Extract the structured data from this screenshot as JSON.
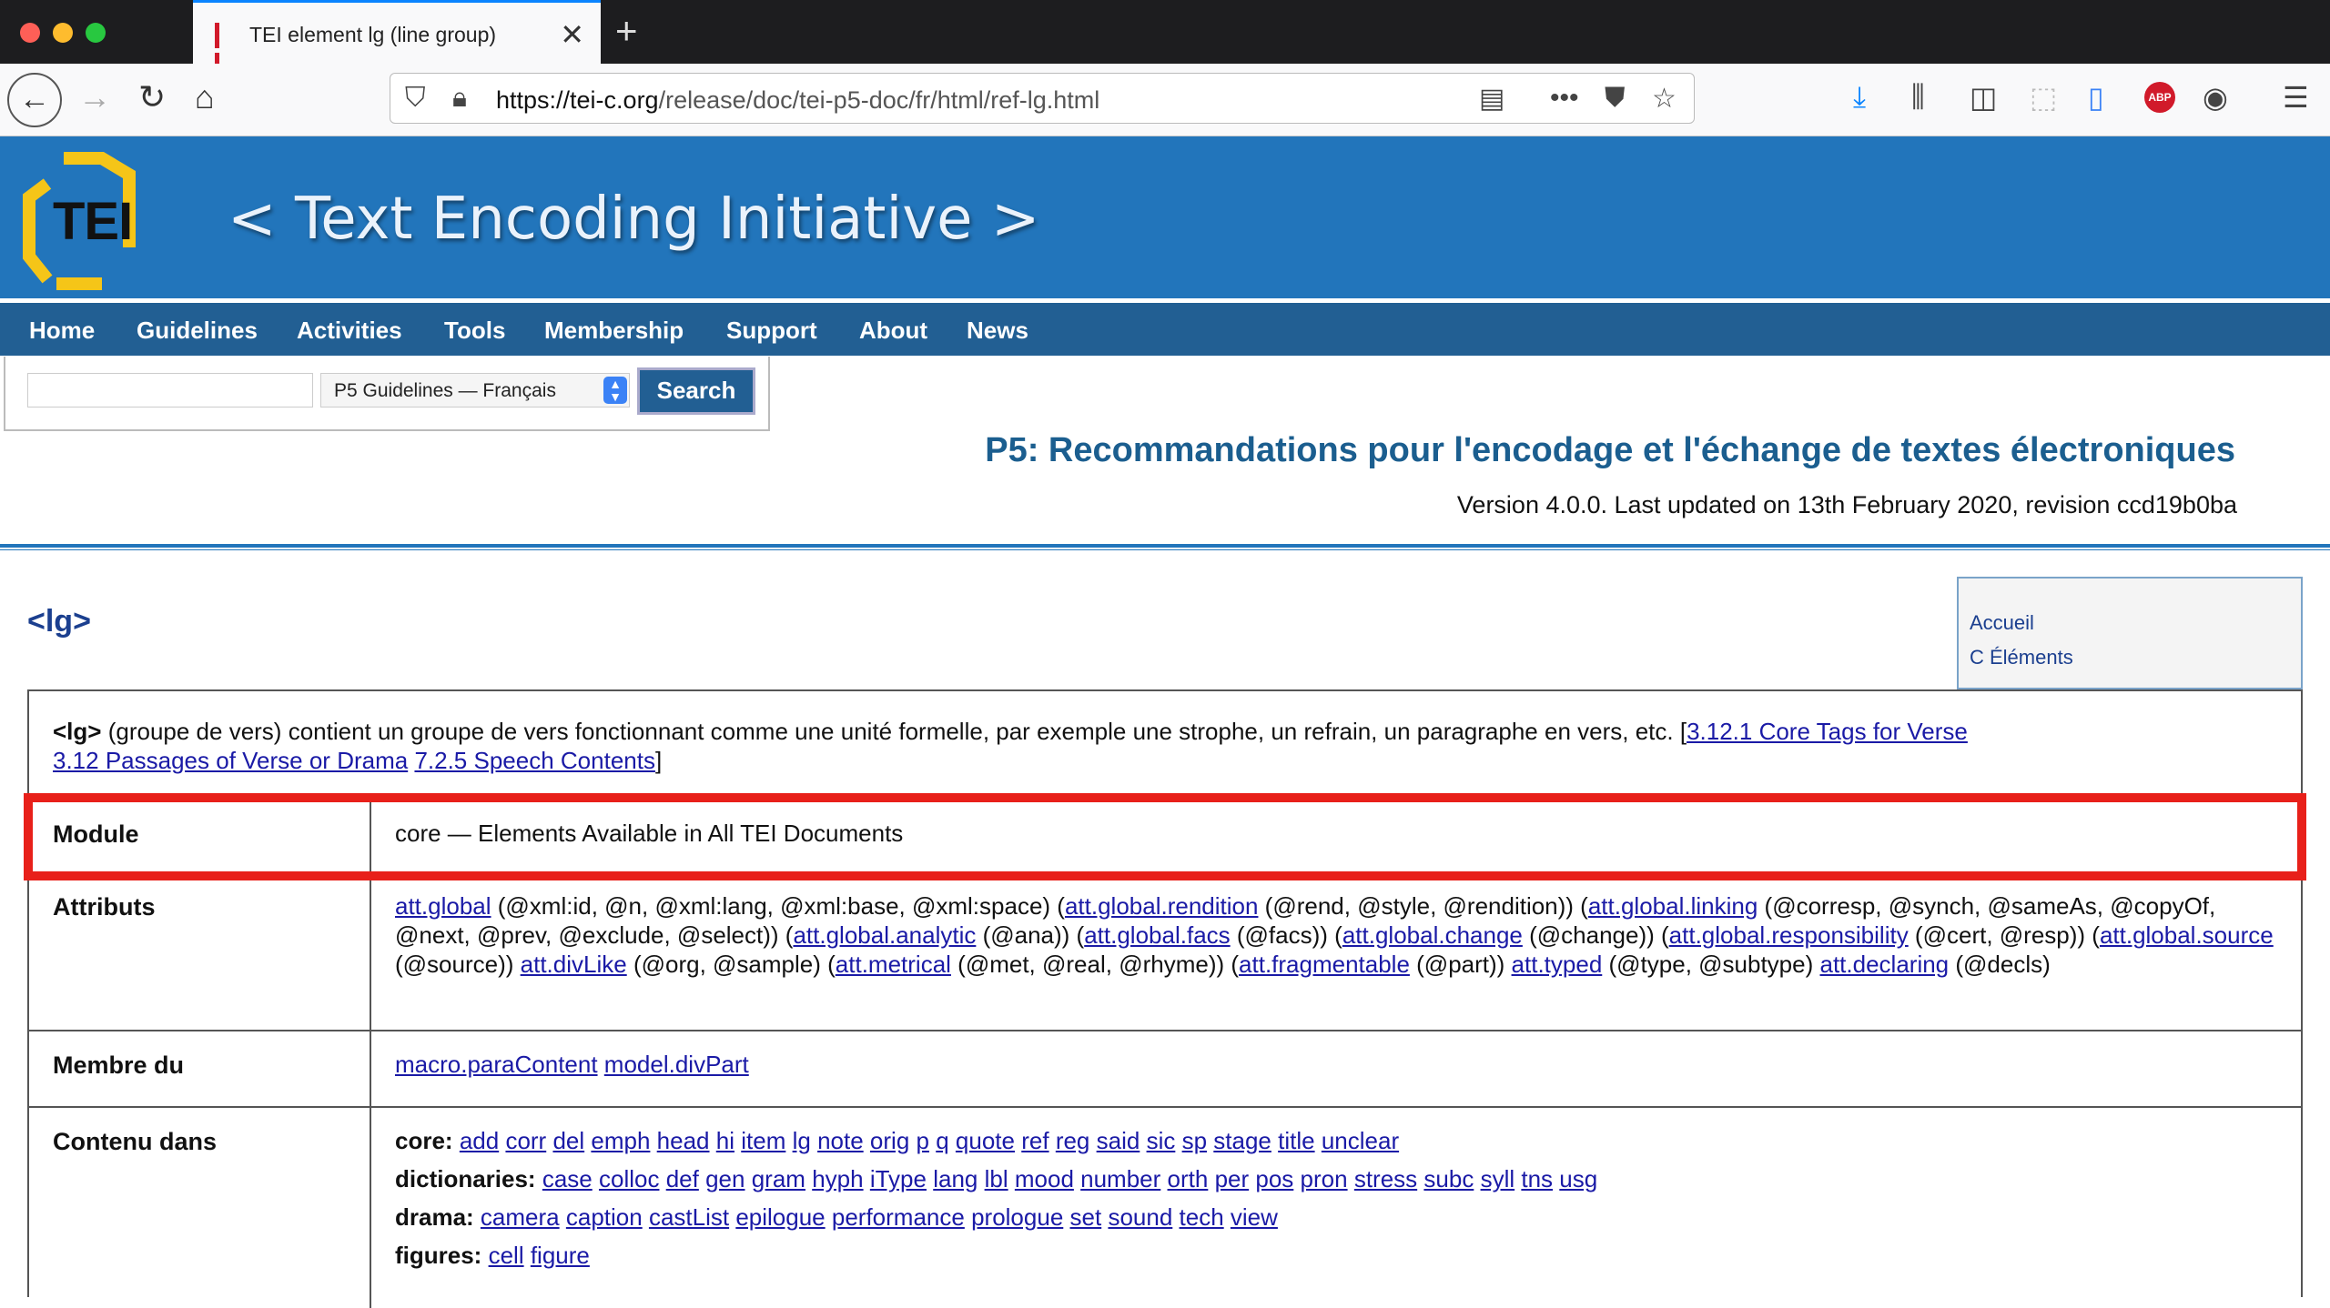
{
  "browser": {
    "tab_title": "TEI element lg (line group)",
    "url_host": "https://tei-c.org",
    "url_path": "/release/doc/tei-p5-doc/fr/html/ref-lg.html"
  },
  "site": {
    "logo": "TEI",
    "title": "< Text Encoding Initiative >",
    "nav": [
      "Home",
      "Guidelines",
      "Activities",
      "Tools",
      "Membership",
      "Support",
      "About",
      "News"
    ],
    "search": {
      "select_value": "P5 Guidelines — Français",
      "button": "Search"
    },
    "doc_title": "P5: Recommandations pour l'encodage et l'échange de textes électroniques",
    "version": "Version 4.0.0. Last updated on 13th February 2020, revision ccd19b0ba"
  },
  "page": {
    "element_name": "<lg>",
    "sidebar": [
      "Accueil",
      "C Éléments"
    ],
    "desc": {
      "tag": "<lg>",
      "text": " (groupe de vers) contient un groupe de vers fonctionnant comme une unité formelle, par exemple une strophe, un refrain, un paragraphe en vers, etc. [",
      "links": [
        "3.12.1 Core Tags for Verse",
        "3.12 Passages of Verse or Drama",
        "7.2.5 Speech Contents"
      ],
      "close": "]"
    },
    "module": {
      "label": "Module",
      "value": "core — Elements Available in All TEI Documents"
    },
    "attributes": {
      "label": "Attributs",
      "parts": [
        {
          "link": "att.global",
          "text": " (@xml:id, @n, @xml:lang, @xml:base, @xml:space) ("
        },
        {
          "link": "att.global.rendition",
          "text": " (@rend, @style, @rendition)) ("
        },
        {
          "link": "att.global.linking",
          "text": " (@corresp, @synch, @sameAs, @copyOf, @next, @prev, @exclude, @select)) ("
        },
        {
          "link": "att.global.analytic",
          "text": " (@ana)) ("
        },
        {
          "link": "att.global.facs",
          "text": " (@facs)) ("
        },
        {
          "link": "att.global.change",
          "text": " (@change)) ("
        },
        {
          "link": "att.global.responsibility",
          "text": " (@cert, @resp)) ("
        },
        {
          "link": "att.global.source",
          "text": " (@source)) "
        },
        {
          "link": "att.divLike",
          "text": " (@org, @sample) ("
        },
        {
          "link": "att.metrical",
          "text": " (@met, @real, @rhyme)) ("
        },
        {
          "link": "att.fragmentable",
          "text": " (@part)) "
        },
        {
          "link": "att.typed",
          "text": " (@type, @subtype) "
        },
        {
          "link": "att.declaring",
          "text": " (@decls)"
        }
      ]
    },
    "member_of": {
      "label": "Membre du",
      "links": [
        "macro.paraContent",
        "model.divPart"
      ]
    },
    "contained_by": {
      "label": "Contenu dans",
      "groups": [
        {
          "name": "core:",
          "items": [
            "add",
            "corr",
            "del",
            "emph",
            "head",
            "hi",
            "item",
            "lg",
            "note",
            "orig",
            "p",
            "q",
            "quote",
            "ref",
            "reg",
            "said",
            "sic",
            "sp",
            "stage",
            "title",
            "unclear"
          ]
        },
        {
          "name": "dictionaries:",
          "items": [
            "case",
            "colloc",
            "def",
            "gen",
            "gram",
            "hyph",
            "iType",
            "lang",
            "lbl",
            "mood",
            "number",
            "orth",
            "per",
            "pos",
            "pron",
            "stress",
            "subc",
            "syll",
            "tns",
            "usg"
          ]
        },
        {
          "name": "drama:",
          "items": [
            "camera",
            "caption",
            "castList",
            "epilogue",
            "performance",
            "prologue",
            "set",
            "sound",
            "tech",
            "view"
          ]
        },
        {
          "name": "figures:",
          "items": [
            "cell",
            "figure"
          ]
        }
      ]
    }
  },
  "colors": {
    "banner": "#2275bb",
    "nav": "#225f93",
    "highlight": "#e8201a"
  }
}
